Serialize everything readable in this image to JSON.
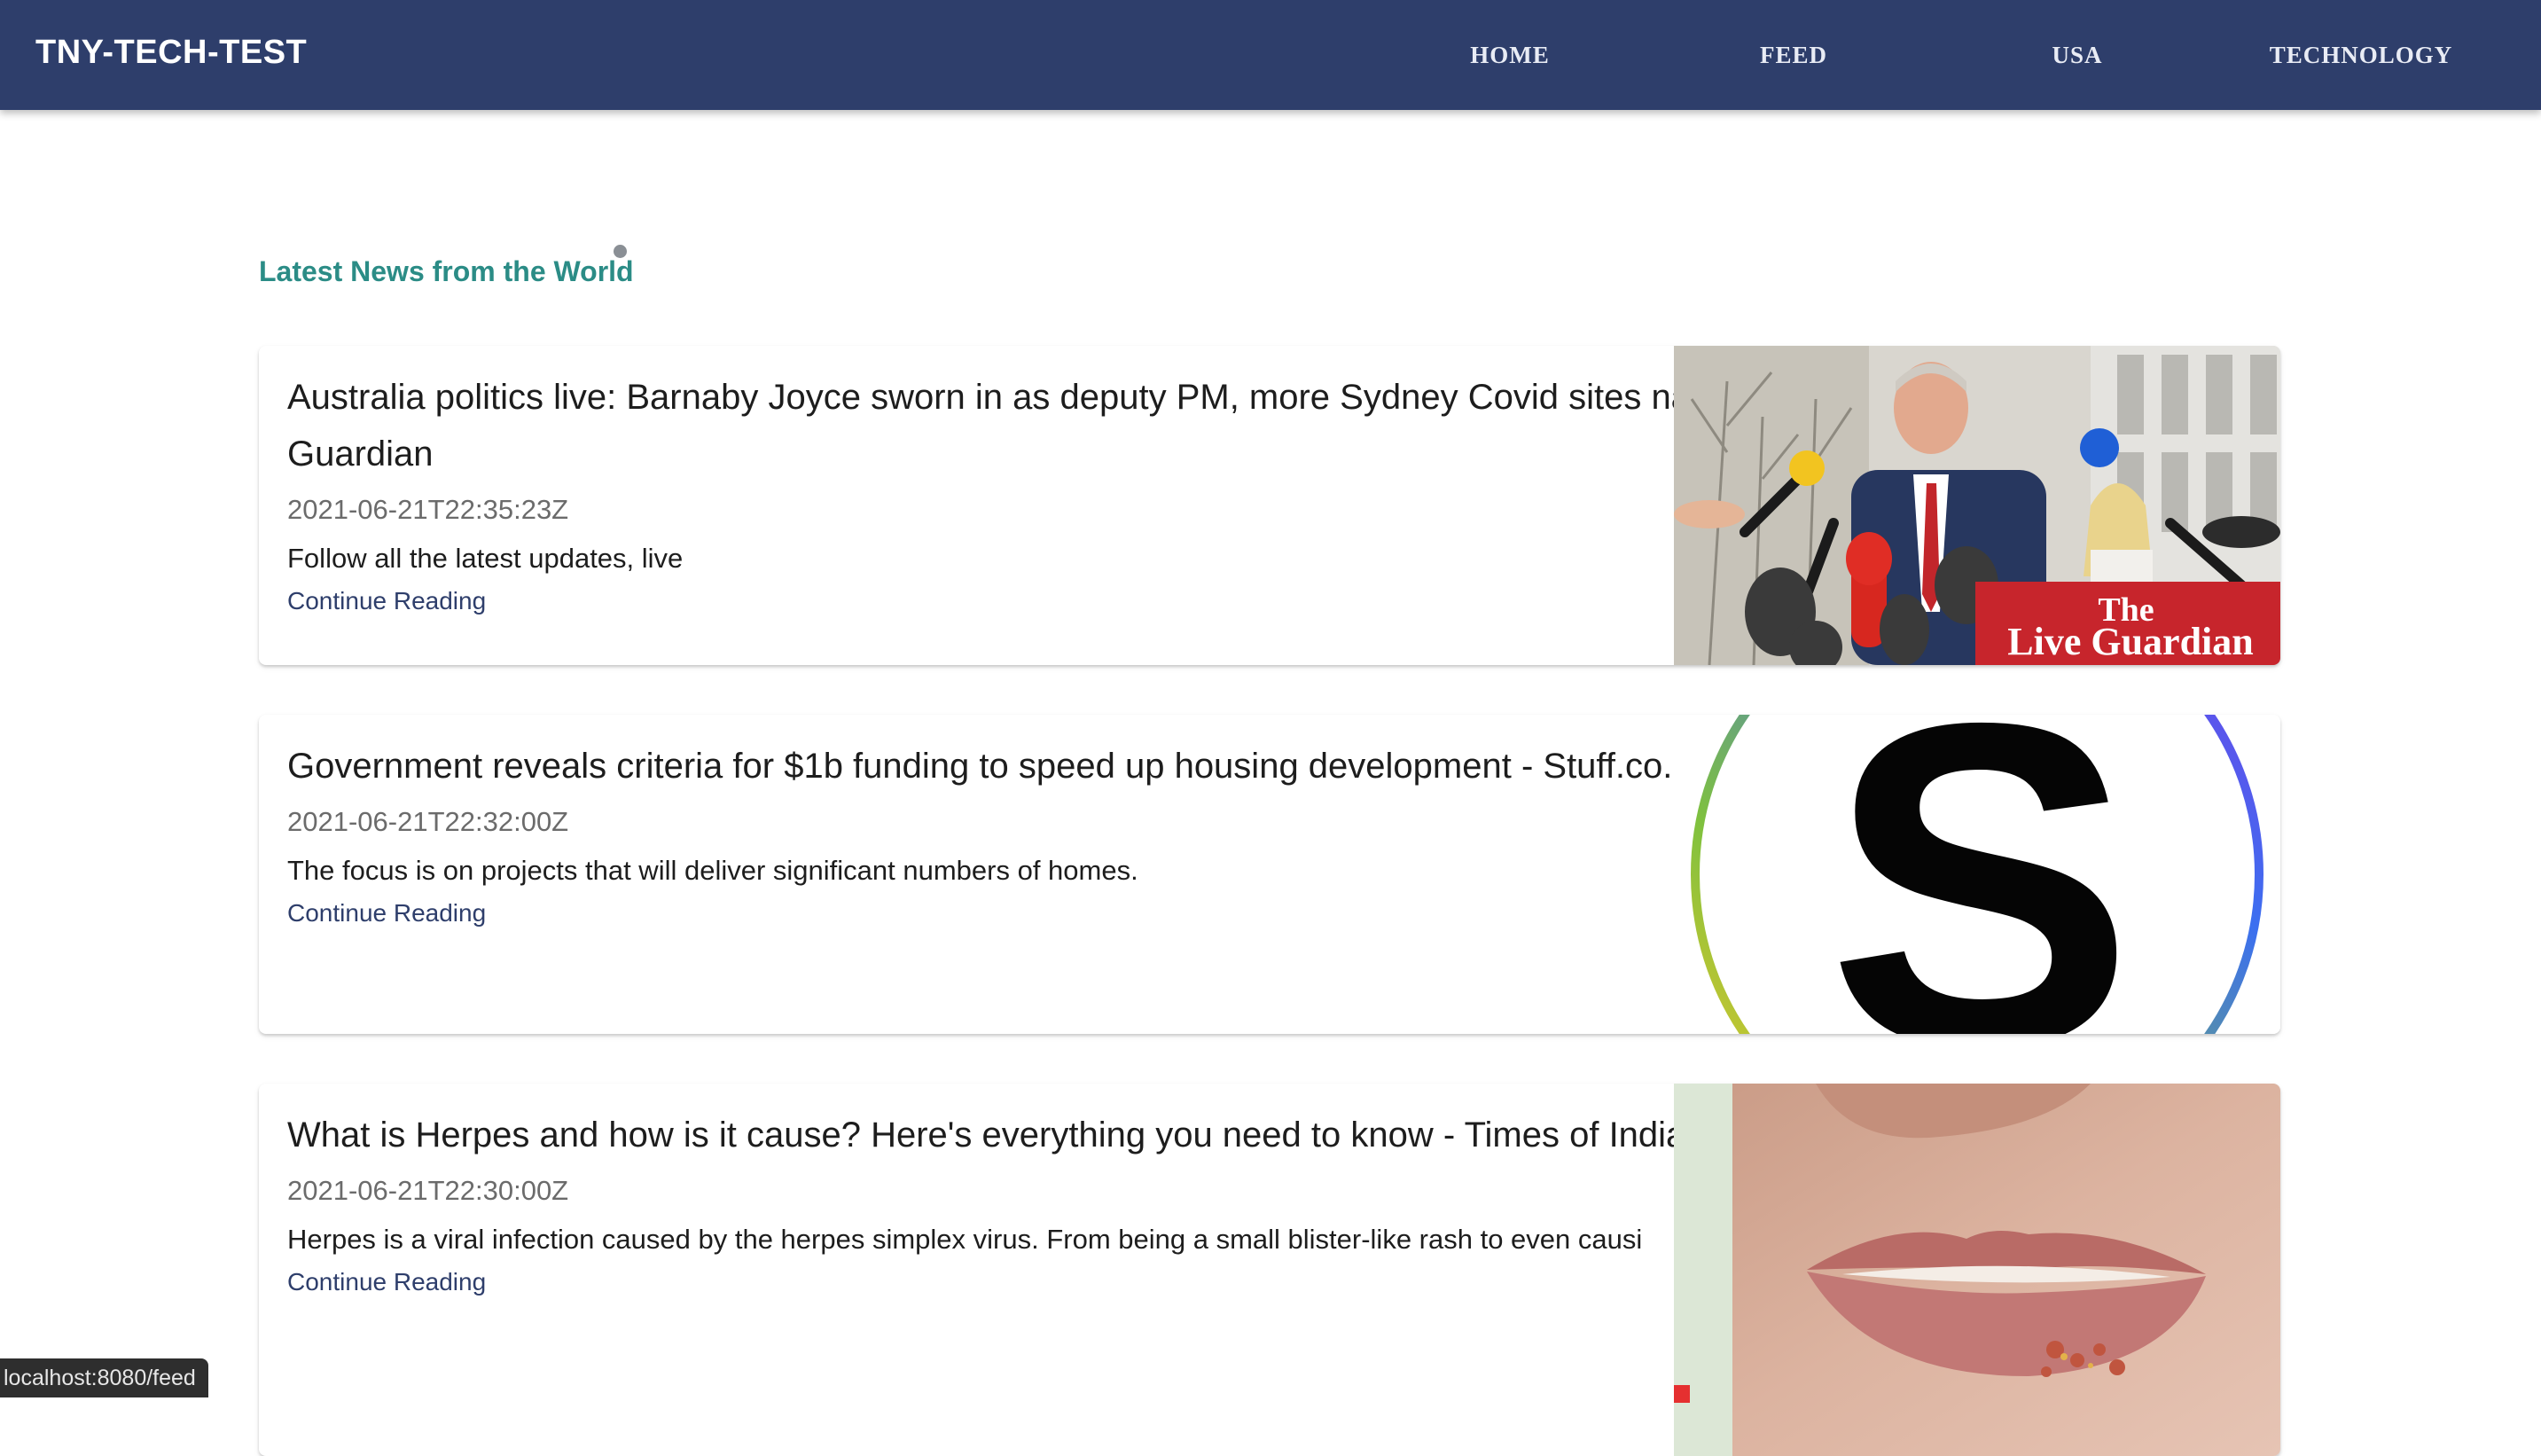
{
  "app": {
    "brand": "TNY-TECH-TEST"
  },
  "nav": {
    "home": "HOME",
    "feed": "FEED",
    "usa": "USA",
    "technology": "TECHNOLOGY"
  },
  "section": {
    "title": "Latest News from the World"
  },
  "articles": [
    {
      "title": "Australia politics live: Barnaby Joyce sworn in as deputy PM, more Sydney Covid sites named - The Guardian",
      "date": "2021-06-21T22:35:23Z",
      "description": "Follow all the latest updates, live",
      "link_label": "Continue Reading",
      "image": {
        "name": "guardian-press-conference-image",
        "logo_line1": "The",
        "logo_line2": "Live Guardian"
      }
    },
    {
      "title": "Government reveals criteria for $1b funding to speed up housing development - Stuff.co.nz",
      "date": "2021-06-21T22:32:00Z",
      "description": "The focus is on projects that will deliver significant numbers of homes.",
      "link_label": "Continue Reading",
      "image": {
        "name": "stuff-logo-image"
      }
    },
    {
      "title": "What is Herpes and how is it cause? Here's everything you need to know - Times of India",
      "date": "2021-06-21T22:30:00Z",
      "description": "Herpes is a viral infection caused by the herpes simplex virus. From being a small blister-like rash to even causi",
      "link_label": "Continue Reading",
      "image": {
        "name": "lips-closeup-image"
      }
    }
  ],
  "status_bar": {
    "url": "localhost:8080/feed"
  },
  "colors": {
    "navbar": "#2e3e6b",
    "section_title": "#2b8c86",
    "link": "#2e3e6b",
    "guardian_red": "#c7252c"
  }
}
